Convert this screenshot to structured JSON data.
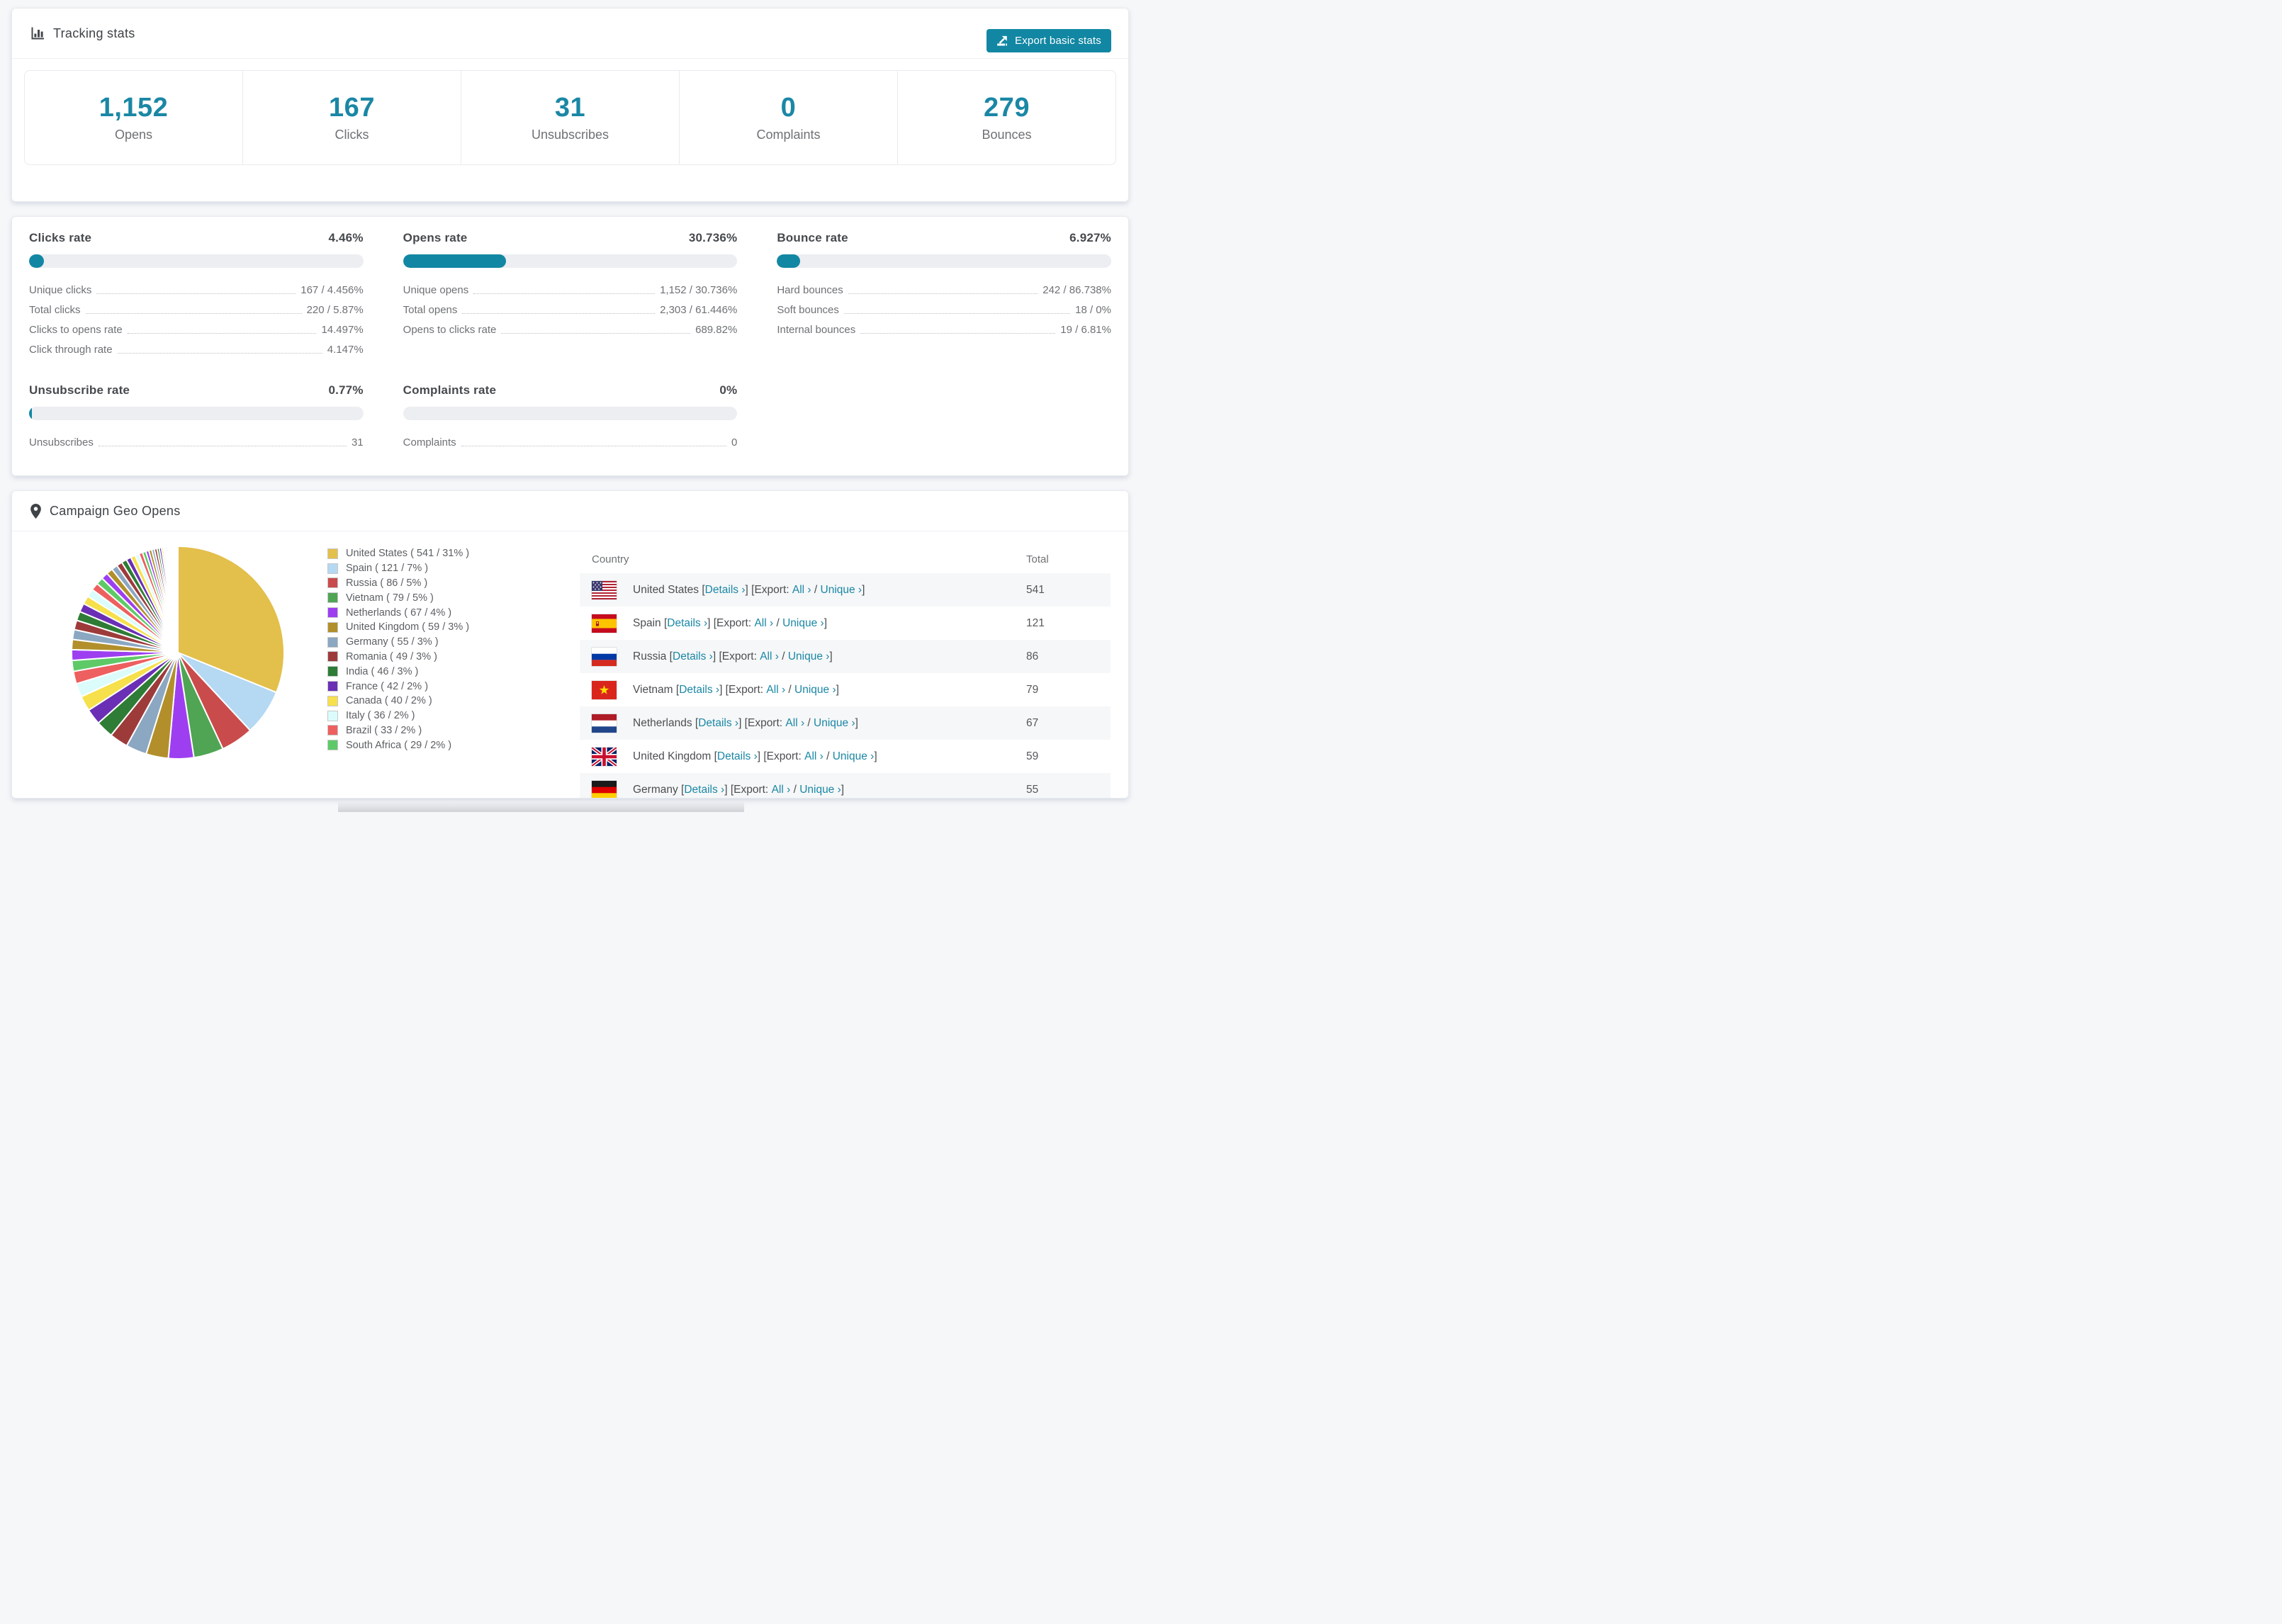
{
  "colors": {
    "accent": "#1a87a5",
    "button_teal": "#1287a3",
    "bar_track": "#eceef1",
    "row_shade": "#f6f7f8"
  },
  "tracking": {
    "title": "Tracking stats",
    "export_button": "Export basic stats",
    "stats": [
      {
        "value": "1,152",
        "label": "Opens"
      },
      {
        "value": "167",
        "label": "Clicks"
      },
      {
        "value": "31",
        "label": "Unsubscribes"
      },
      {
        "value": "0",
        "label": "Complaints"
      },
      {
        "value": "279",
        "label": "Bounces"
      }
    ]
  },
  "rates": [
    {
      "title": "Clicks rate",
      "value": "4.46%",
      "bar_pct": 4.46,
      "rows": [
        [
          "Unique clicks",
          "167 / 4.456%"
        ],
        [
          "Total clicks",
          "220 / 5.87%"
        ],
        [
          "Clicks to opens rate",
          "14.497%"
        ],
        [
          "Click through rate",
          "4.147%"
        ]
      ]
    },
    {
      "title": "Opens rate",
      "value": "30.736%",
      "bar_pct": 30.736,
      "rows": [
        [
          "Unique opens",
          "1,152 / 30.736%"
        ],
        [
          "Total opens",
          "2,303 / 61.446%"
        ],
        [
          "Opens to clicks rate",
          "689.82%"
        ]
      ]
    },
    {
      "title": "Bounce rate",
      "value": "6.927%",
      "bar_pct": 6.927,
      "rows": [
        [
          "Hard bounces",
          "242 / 86.738%"
        ],
        [
          "Soft bounces",
          "18 / 0%"
        ],
        [
          "Internal bounces",
          "19 / 6.81%"
        ]
      ]
    },
    {
      "title": "Unsubscribe rate",
      "value": "0.77%",
      "bar_pct": 0.77,
      "rows": [
        [
          "Unsubscribes",
          "31"
        ]
      ]
    },
    {
      "title": "Complaints rate",
      "value": "0%",
      "bar_pct": 0,
      "rows": [
        [
          "Complaints",
          "0"
        ]
      ]
    }
  ],
  "geo": {
    "title": "Campaign Geo Opens",
    "table": {
      "columns": [
        "Country",
        "Total"
      ],
      "link_labels": {
        "details": "Details",
        "export": "Export:",
        "all": "All",
        "unique": "Unique",
        "chevron": "›"
      },
      "rows": [
        {
          "country": "United States",
          "flag": "us",
          "total": "541"
        },
        {
          "country": "Spain",
          "flag": "es",
          "total": "121"
        },
        {
          "country": "Russia",
          "flag": "ru",
          "total": "86"
        },
        {
          "country": "Vietnam",
          "flag": "vn",
          "total": "79"
        },
        {
          "country": "Netherlands",
          "flag": "nl",
          "total": "67"
        },
        {
          "country": "United Kingdom",
          "flag": "gb",
          "total": "59"
        },
        {
          "country": "Germany",
          "flag": "de",
          "total": "55"
        }
      ]
    },
    "chart_data": {
      "type": "pie",
      "title": "Campaign Geo Opens",
      "unit": "opens",
      "start_angle_deg": -90,
      "direction": "clockwise",
      "legend_position": "right",
      "series": [
        {
          "name": "United States",
          "value": 541,
          "pct": "31%",
          "color": "#e3bf4b"
        },
        {
          "name": "Spain",
          "value": 121,
          "pct": "7%",
          "color": "#b5d8f3"
        },
        {
          "name": "Russia",
          "value": 86,
          "pct": "5%",
          "color": "#ca4b4b"
        },
        {
          "name": "Vietnam",
          "value": 79,
          "pct": "5%",
          "color": "#4fa553"
        },
        {
          "name": "Netherlands",
          "value": 67,
          "pct": "4%",
          "color": "#9d3ff0"
        },
        {
          "name": "United Kingdom",
          "value": 59,
          "pct": "3%",
          "color": "#b28f2b"
        },
        {
          "name": "Germany",
          "value": 55,
          "pct": "3%",
          "color": "#8ba7c2"
        },
        {
          "name": "Romania",
          "value": 49,
          "pct": "3%",
          "color": "#9d3b3b"
        },
        {
          "name": "India",
          "value": 46,
          "pct": "3%",
          "color": "#2e7c35"
        },
        {
          "name": "France",
          "value": 42,
          "pct": "2%",
          "color": "#6a2fb5"
        },
        {
          "name": "Canada",
          "value": 40,
          "pct": "2%",
          "color": "#f6e04b"
        },
        {
          "name": "Italy",
          "value": 36,
          "pct": "2%",
          "color": "#dcfcfc"
        },
        {
          "name": "Brazil",
          "value": 33,
          "pct": "2%",
          "color": "#ee5f5f"
        },
        {
          "name": "South Africa",
          "value": 29,
          "pct": "2%",
          "color": "#5eca67"
        }
      ],
      "others_unlabeled": {
        "note": "small unlabeled countries drawn as thin slices, colors repeat series 5-14",
        "values": [
          28,
          27,
          26,
          25,
          24,
          23,
          22,
          21,
          20,
          19,
          18,
          17,
          16,
          15,
          14,
          13,
          12,
          11,
          10,
          9,
          8,
          8,
          7,
          7,
          6,
          6,
          5,
          5,
          4,
          4,
          3,
          3,
          3,
          2,
          2,
          2,
          2,
          1,
          1,
          1,
          1,
          1,
          1,
          1,
          1
        ]
      }
    }
  }
}
